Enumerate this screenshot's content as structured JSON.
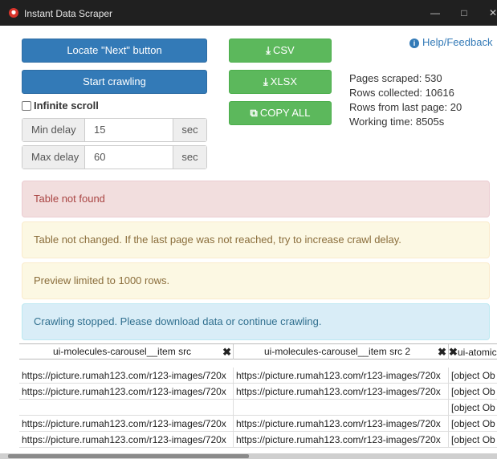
{
  "window": {
    "title": "Instant Data Scraper"
  },
  "buttons": {
    "locate_next": "Locate \"Next\" button",
    "start_crawling": "Start crawling",
    "csv": "CSV",
    "xlsx": "XLSX",
    "copy_all": "COPY ALL"
  },
  "help_link": "Help/Feedback",
  "infinite_scroll": {
    "label": "Infinite scroll",
    "checked": false
  },
  "min_delay": {
    "label": "Min delay",
    "value": "15",
    "unit": "sec"
  },
  "max_delay": {
    "label": "Max delay",
    "value": "60",
    "unit": "sec"
  },
  "stats": {
    "pages_scraped": "Pages scraped: 530",
    "rows_collected": "Rows collected: 10616",
    "rows_last_page": "Rows from last page: 20",
    "working_time": "Working time: 8505s"
  },
  "alerts": {
    "table_not_found": "Table not found",
    "table_not_changed": "Table not changed. If the last page was not reached, try to increase crawl delay.",
    "preview_limited": "Preview limited to 1000 rows.",
    "crawling_stopped": "Crawling stopped. Please download data or continue crawling."
  },
  "table": {
    "columns": [
      "ui-molecules-carousel__item src",
      "ui-molecules-carousel__item src 2",
      "ui-atomic-li"
    ],
    "rows": [
      [
        "https://picture.rumah123.com/r123-images/720x",
        "https://picture.rumah123.com/r123-images/720x",
        "[object Ob"
      ],
      [
        "https://picture.rumah123.com/r123-images/720x",
        "https://picture.rumah123.com/r123-images/720x",
        "[object Ob"
      ],
      [
        "",
        "",
        "[object Ob"
      ],
      [
        "https://picture.rumah123.com/r123-images/720x",
        "https://picture.rumah123.com/r123-images/720x",
        "[object Ob"
      ],
      [
        "https://picture.rumah123.com/r123-images/720x",
        "https://picture.rumah123.com/r123-images/720x",
        "[object Ob"
      ]
    ]
  },
  "colors": {
    "primary": "#337ab7",
    "success": "#5cb85c",
    "titlebar": "#202020"
  }
}
